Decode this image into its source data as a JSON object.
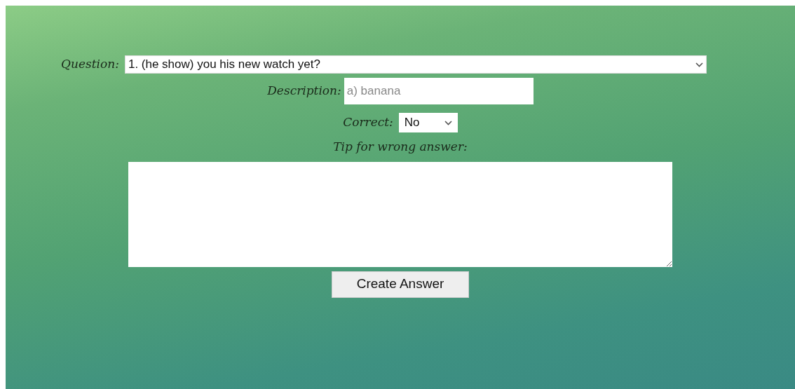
{
  "form": {
    "question": {
      "label": "Question:",
      "value": "1. (he show) you his new watch yet?"
    },
    "description": {
      "label": "Description:",
      "placeholder": "a) banana"
    },
    "correct": {
      "label": "Correct:",
      "value": "No"
    },
    "tip": {
      "label": "Tip for wrong answer:"
    },
    "submit": {
      "label": "Create Answer"
    }
  }
}
